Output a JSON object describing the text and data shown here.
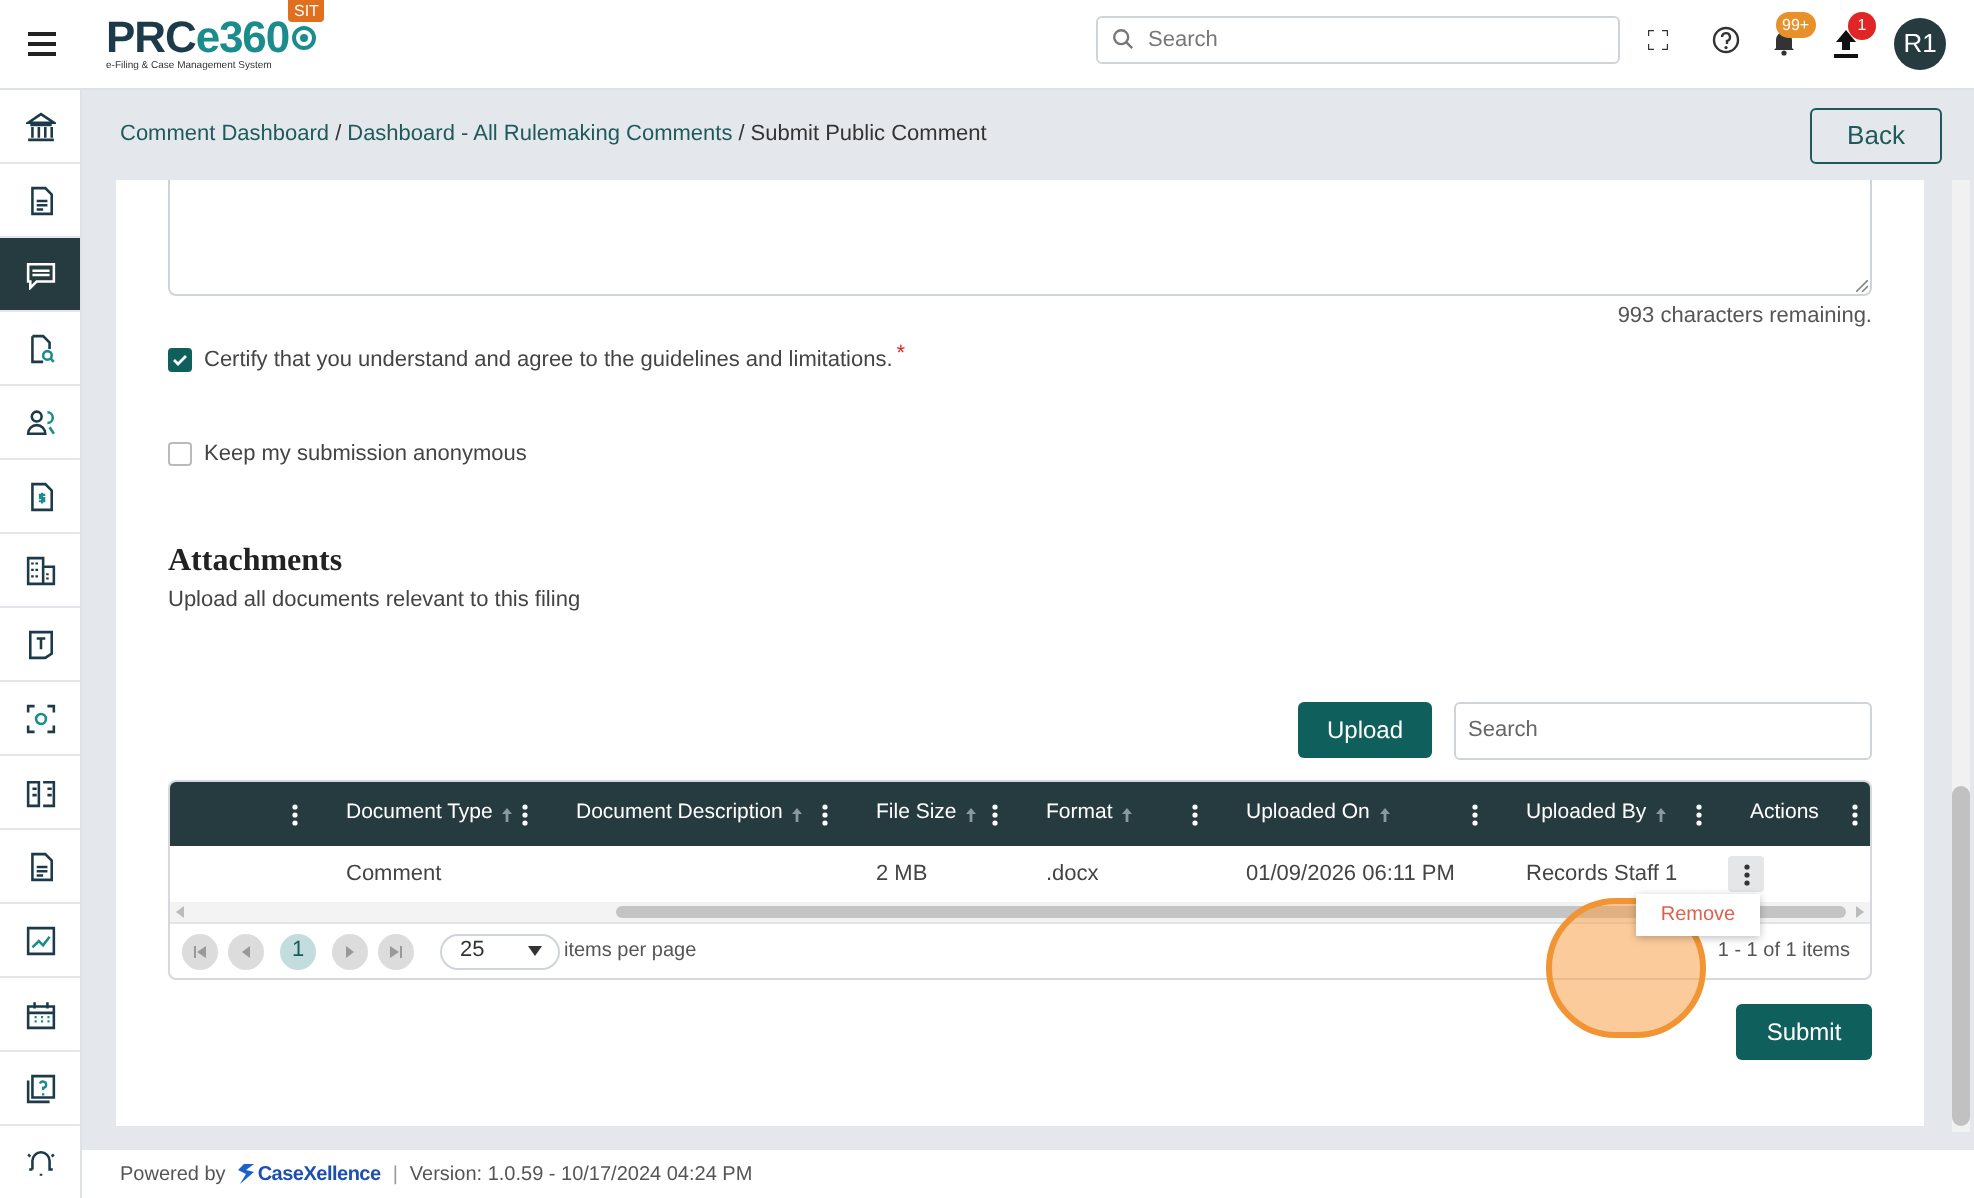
{
  "header": {
    "logo": [
      "PRC",
      "e360"
    ],
    "logo_subtitle": "e-Filing & Case Management System",
    "env_badge": "SIT",
    "search": {
      "placeholder": "Search"
    },
    "notifications_badge": "99+",
    "uploads_badge": "1",
    "avatar": "R1"
  },
  "sidebar": {
    "items": [
      {
        "selected": false
      },
      {
        "selected": false
      },
      {
        "selected": true
      },
      {
        "selected": false
      },
      {
        "selected": false
      },
      {
        "selected": false
      },
      {
        "selected": false
      },
      {
        "selected": false
      },
      {
        "selected": false
      },
      {
        "selected": false
      },
      {
        "selected": false
      },
      {
        "selected": false
      },
      {
        "selected": false
      },
      {
        "selected": false
      },
      {
        "selected": false
      }
    ]
  },
  "breadcrumb": {
    "items": [
      "Comment Dashboard",
      "Dashboard - All Rulemaking Comments",
      "Submit Public Comment"
    ],
    "separator": "/"
  },
  "back_button": "Back",
  "comment": {
    "characters_remaining": "993 characters remaining."
  },
  "options": [
    {
      "label": "Certify that you understand and agree to the guidelines and limitations.",
      "required_mark": "*",
      "checked": true
    },
    {
      "label": "Keep my submission anonymous",
      "checked": false
    }
  ],
  "attachments": {
    "title": "Attachments",
    "subtitle": "Upload all documents relevant to this filing",
    "upload_button": "Upload",
    "search": {
      "placeholder": "Search"
    },
    "table": {
      "columns": [
        {
          "sortable": false
        },
        {
          "label": "Document Type",
          "sortable": true
        },
        {
          "label": "Document Description",
          "sortable": true
        },
        {
          "label": "File Size",
          "sortable": true
        },
        {
          "label": "Format",
          "sortable": true
        },
        {
          "label": "Uploaded On",
          "sortable": true
        },
        {
          "label": "Uploaded By",
          "sortable": true
        },
        {
          "label": "Actions",
          "sortable": false
        }
      ],
      "rows": [
        {
          "document_type": "Comment",
          "file_size": "2 MB",
          "format": ".docx",
          "uploaded_on": "01/09/2026 06:11 PM",
          "uploaded_by": "Records Staff 1",
          "menu_open": true
        }
      ]
    },
    "actions_menu": {
      "items": [
        "Remove"
      ]
    },
    "pager": {
      "pages": [
        {
          "label": "1",
          "selected": true
        }
      ],
      "page_size": "25",
      "page_size_label": "items per page",
      "summary": "1 - 1 of 1 items"
    }
  },
  "submit_button": "Submit",
  "footer": {
    "powered_by": "Powered by",
    "brand": "CaseXellence",
    "divider": "|",
    "version": "Version: 1.0.59 - 10/17/2024 04:24 PM"
  }
}
